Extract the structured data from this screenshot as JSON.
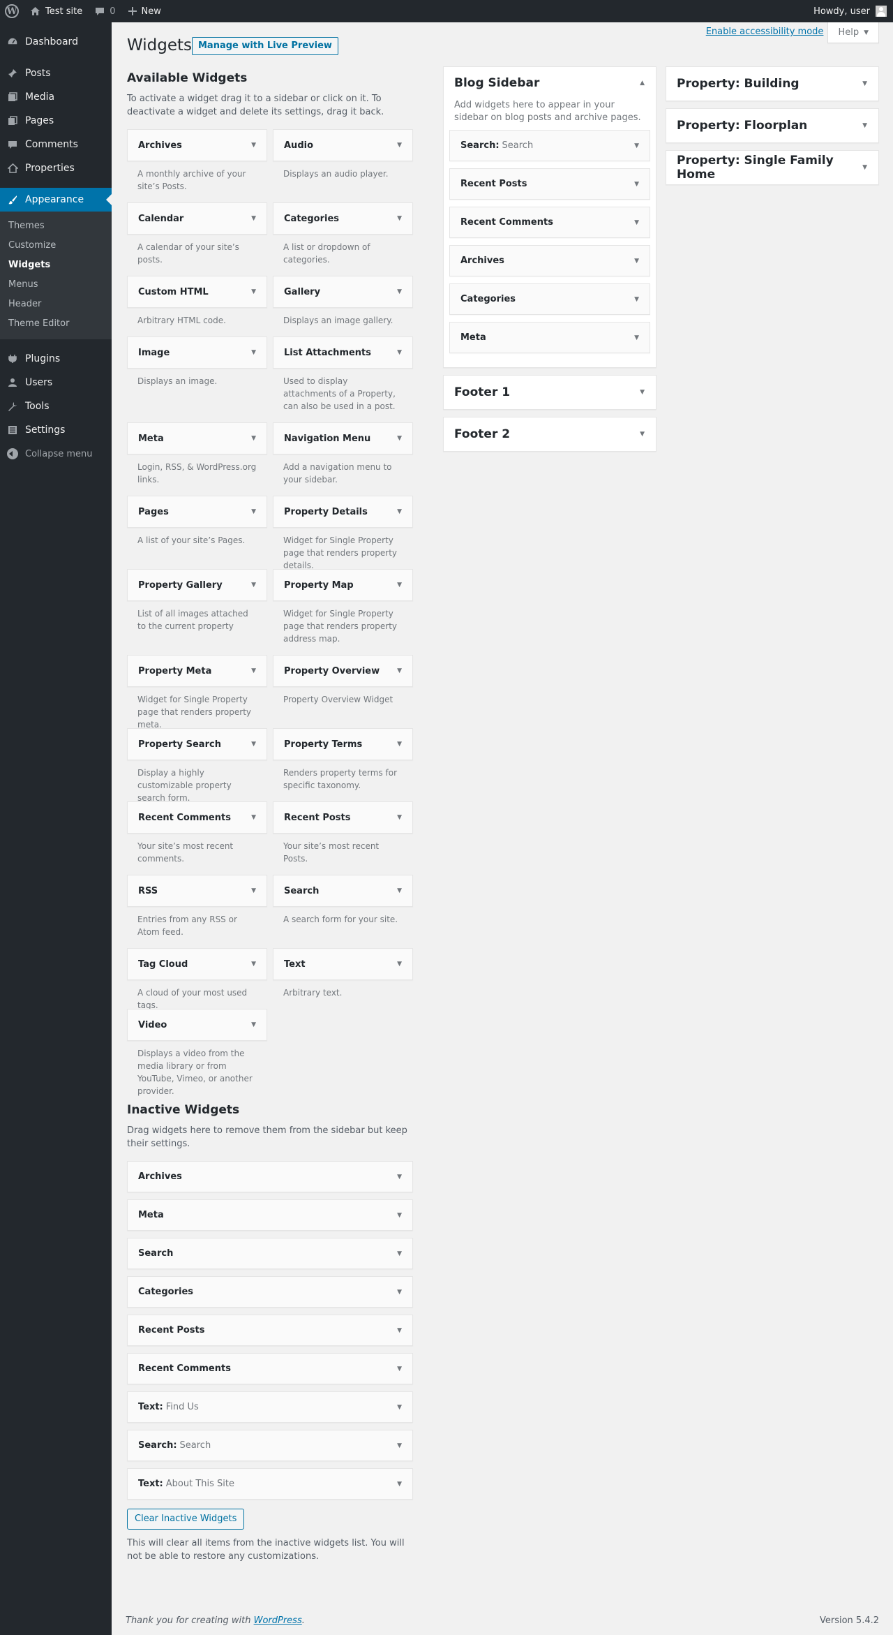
{
  "adminbar": {
    "site_name": "Test site",
    "comments_count": "0",
    "new_label": "New",
    "howdy": "Howdy, user"
  },
  "menu": {
    "items": [
      {
        "label": "Dashboard",
        "icon": "dashboard-icon"
      },
      {
        "label": "Posts",
        "icon": "pin-icon"
      },
      {
        "label": "Media",
        "icon": "media-icon"
      },
      {
        "label": "Pages",
        "icon": "pages-icon"
      },
      {
        "label": "Comments",
        "icon": "comment-icon"
      },
      {
        "label": "Properties",
        "icon": "home-icon"
      },
      {
        "label": "Appearance",
        "icon": "paintbrush-icon"
      },
      {
        "label": "Plugins",
        "icon": "plugin-icon"
      },
      {
        "label": "Users",
        "icon": "users-icon"
      },
      {
        "label": "Tools",
        "icon": "wrench-icon"
      },
      {
        "label": "Settings",
        "icon": "settings-icon"
      }
    ],
    "appearance_sub": [
      "Themes",
      "Customize",
      "Widgets",
      "Menus",
      "Header",
      "Theme Editor"
    ],
    "collapse": "Collapse menu"
  },
  "screen_meta": {
    "a11y": "Enable accessibility mode",
    "help": "Help"
  },
  "page": {
    "title": "Widgets",
    "action": "Manage with Live Preview"
  },
  "available": {
    "heading": "Available Widgets",
    "description": "To activate a widget drag it to a sidebar or click on it. To deactivate a widget and delete its settings, drag it back.",
    "widgets": [
      {
        "title": "Archives",
        "desc": "A monthly archive of your site’s Posts."
      },
      {
        "title": "Audio",
        "desc": "Displays an audio player."
      },
      {
        "title": "Calendar",
        "desc": "A calendar of your site’s posts."
      },
      {
        "title": "Categories",
        "desc": "A list or dropdown of categories."
      },
      {
        "title": "Custom HTML",
        "desc": "Arbitrary HTML code."
      },
      {
        "title": "Gallery",
        "desc": "Displays an image gallery."
      },
      {
        "title": "Image",
        "desc": "Displays an image."
      },
      {
        "title": "List Attachments",
        "desc": "Used to display attachments of a Property, can also be used in a post."
      },
      {
        "title": "Meta",
        "desc": "Login, RSS, & WordPress.org links."
      },
      {
        "title": "Navigation Menu",
        "desc": "Add a navigation menu to your sidebar."
      },
      {
        "title": "Pages",
        "desc": "A list of your site’s Pages."
      },
      {
        "title": "Property Details",
        "desc": "Widget for Single Property page that renders property details."
      },
      {
        "title": "Property Gallery",
        "desc": "List of all images attached to the current property"
      },
      {
        "title": "Property Map",
        "desc": "Widget for Single Property page that renders property address map."
      },
      {
        "title": "Property Meta",
        "desc": "Widget for Single Property page that renders property meta."
      },
      {
        "title": "Property Overview",
        "desc": "Property Overview Widget"
      },
      {
        "title": "Property Search",
        "desc": "Display a highly customizable property search form."
      },
      {
        "title": "Property Terms",
        "desc": "Renders property terms for specific taxonomy."
      },
      {
        "title": "Recent Comments",
        "desc": "Your site’s most recent comments."
      },
      {
        "title": "Recent Posts",
        "desc": "Your site’s most recent Posts."
      },
      {
        "title": "RSS",
        "desc": "Entries from any RSS or Atom feed."
      },
      {
        "title": "Search",
        "desc": "A search form for your site."
      },
      {
        "title": "Tag Cloud",
        "desc": "A cloud of your most used tags."
      },
      {
        "title": "Text",
        "desc": "Arbitrary text."
      },
      {
        "title": "Video",
        "desc": "Displays a video from the media library or from YouTube, Vimeo, or another provider."
      }
    ]
  },
  "inactive": {
    "heading": "Inactive Widgets",
    "description": "Drag widgets here to remove them from the sidebar but keep their settings.",
    "widgets": [
      {
        "title": "Archives",
        "in_title": ""
      },
      {
        "title": "Meta",
        "in_title": ""
      },
      {
        "title": "Search",
        "in_title": ""
      },
      {
        "title": "Categories",
        "in_title": ""
      },
      {
        "title": "Recent Posts",
        "in_title": ""
      },
      {
        "title": "Recent Comments",
        "in_title": ""
      },
      {
        "title": "Text:",
        "in_title": "Find Us"
      },
      {
        "title": "Search:",
        "in_title": "Search"
      },
      {
        "title": "Text:",
        "in_title": "About This Site"
      }
    ],
    "clear_button": "Clear Inactive Widgets",
    "note": "This will clear all items from the inactive widgets list. You will not be able to restore any customizations."
  },
  "sidebars": {
    "blog": {
      "title": "Blog Sidebar",
      "description": "Add widgets here to appear in your sidebar on blog posts and archive pages.",
      "widgets": [
        {
          "title": "Search:",
          "in_title": "Search"
        },
        {
          "title": "Recent Posts",
          "in_title": ""
        },
        {
          "title": "Recent Comments",
          "in_title": ""
        },
        {
          "title": "Archives",
          "in_title": ""
        },
        {
          "title": "Categories",
          "in_title": ""
        },
        {
          "title": "Meta",
          "in_title": ""
        }
      ]
    },
    "footer1": {
      "title": "Footer 1"
    },
    "footer2": {
      "title": "Footer 2"
    },
    "right": [
      "Property: Building",
      "Property: Floorplan",
      "Property: Single Family Home"
    ]
  },
  "footer": {
    "thanks_prefix": "Thank you for creating with",
    "thanks_link": "WordPress",
    "version": "Version 5.4.2"
  },
  "colors": {
    "admin_bar": "#23282d",
    "menu_current": "#0073aa",
    "link": "#0073aa",
    "page_bg": "#f1f1f1"
  }
}
